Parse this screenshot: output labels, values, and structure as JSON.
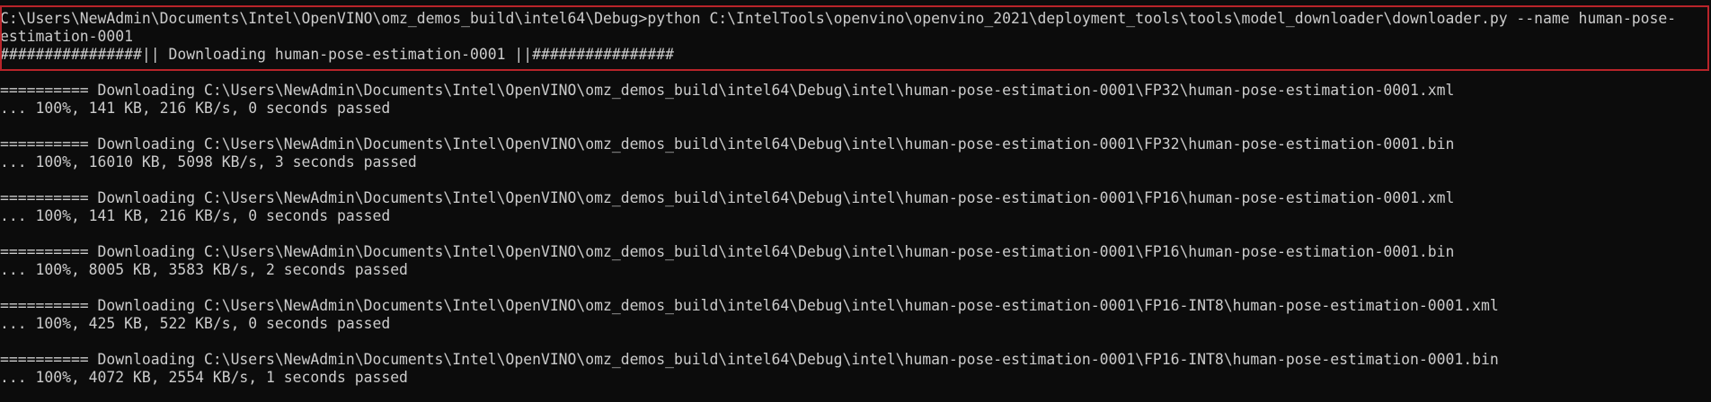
{
  "highlight_color": "#b8242a",
  "console": {
    "command_line_1": "C:\\Users\\NewAdmin\\Documents\\Intel\\OpenVINO\\omz_demos_build\\intel64\\Debug>python C:\\IntelTools\\openvino\\openvino_2021\\deployment_tools\\tools\\model_downloader\\downloader.py --name human-pose-",
    "command_line_2": "estimation-0001",
    "banner": "################|| Downloading human-pose-estimation-0001 ||################",
    "downloads": [
      {
        "header": "========== Downloading C:\\Users\\NewAdmin\\Documents\\Intel\\OpenVINO\\omz_demos_build\\intel64\\Debug\\intel\\human-pose-estimation-0001\\FP32\\human-pose-estimation-0001.xml",
        "progress": "... 100%, 141 KB, 216 KB/s, 0 seconds passed"
      },
      {
        "header": "========== Downloading C:\\Users\\NewAdmin\\Documents\\Intel\\OpenVINO\\omz_demos_build\\intel64\\Debug\\intel\\human-pose-estimation-0001\\FP32\\human-pose-estimation-0001.bin",
        "progress": "... 100%, 16010 KB, 5098 KB/s, 3 seconds passed"
      },
      {
        "header": "========== Downloading C:\\Users\\NewAdmin\\Documents\\Intel\\OpenVINO\\omz_demos_build\\intel64\\Debug\\intel\\human-pose-estimation-0001\\FP16\\human-pose-estimation-0001.xml",
        "progress": "... 100%, 141 KB, 216 KB/s, 0 seconds passed"
      },
      {
        "header": "========== Downloading C:\\Users\\NewAdmin\\Documents\\Intel\\OpenVINO\\omz_demos_build\\intel64\\Debug\\intel\\human-pose-estimation-0001\\FP16\\human-pose-estimation-0001.bin",
        "progress": "... 100%, 8005 KB, 3583 KB/s, 2 seconds passed"
      },
      {
        "header": "========== Downloading C:\\Users\\NewAdmin\\Documents\\Intel\\OpenVINO\\omz_demos_build\\intel64\\Debug\\intel\\human-pose-estimation-0001\\FP16-INT8\\human-pose-estimation-0001.xml",
        "progress": "... 100%, 425 KB, 522 KB/s, 0 seconds passed"
      },
      {
        "header": "========== Downloading C:\\Users\\NewAdmin\\Documents\\Intel\\OpenVINO\\omz_demos_build\\intel64\\Debug\\intel\\human-pose-estimation-0001\\FP16-INT8\\human-pose-estimation-0001.bin",
        "progress": "... 100%, 4072 KB, 2554 KB/s, 1 seconds passed"
      }
    ]
  }
}
